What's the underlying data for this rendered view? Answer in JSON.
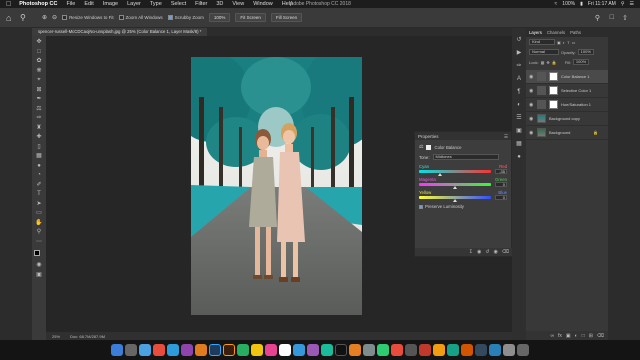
{
  "menubar": {
    "app": "Photoshop CC",
    "items": [
      "File",
      "Edit",
      "Image",
      "Layer",
      "Type",
      "Select",
      "Filter",
      "3D",
      "View",
      "Window",
      "Help"
    ],
    "window_title": "Adobe Photoshop CC 2018",
    "battery": "100%",
    "clock": "Fri 11:17 AM"
  },
  "options": {
    "resize_windows": "Resize Windows to Fit",
    "zoom_all": "Zoom All Windows",
    "scrubby_zoom": "Scrubby Zoom",
    "zoom_value": "100%",
    "fit_screen": "Fit Screen",
    "fill_screen": "Fill Screen"
  },
  "document": {
    "tab_title": "spencer-russell-McCDCaojNo-unsplash.jpg @ 25% (Color Balance 1, Layer Mask/8) *",
    "zoom": "25%",
    "doc_size": "Doc: 68.7M/287.9M"
  },
  "properties": {
    "panel_title": "Properties",
    "adjustment": "Color Balance",
    "tone_label": "Tone:",
    "tone_value": "Midtones",
    "sliders": [
      {
        "left": "Cyan",
        "right": "Red",
        "value": "-35",
        "fraction": 0.29
      },
      {
        "left": "Magenta",
        "right": "Green",
        "value": "0",
        "fraction": 0.5
      },
      {
        "left": "Yellow",
        "right": "Blue",
        "value": "0",
        "fraction": 0.5
      }
    ],
    "preserve_luminosity": "Preserve Luminosity"
  },
  "layers_panel": {
    "tabs": [
      "Layers",
      "Channels",
      "Paths"
    ],
    "kind": "Kind",
    "blend_mode": "Normal",
    "opacity_label": "Opacity:",
    "opacity": "100%",
    "lock_label": "Lock:",
    "fill_label": "Fill:",
    "fill": "100%",
    "layers": [
      {
        "name": "Color Balance 1",
        "type": "adjustment",
        "selected": true
      },
      {
        "name": "Selective Color 1",
        "type": "adjustment",
        "selected": false
      },
      {
        "name": "Hue/Saturation 1",
        "type": "adjustment",
        "selected": false
      },
      {
        "name": "Background copy",
        "type": "pixel",
        "selected": false
      },
      {
        "name": "Background",
        "type": "pixel",
        "selected": false
      }
    ]
  },
  "colors": {
    "teal": "#1c8c8c",
    "photo_sky": "#e8e8e4"
  }
}
